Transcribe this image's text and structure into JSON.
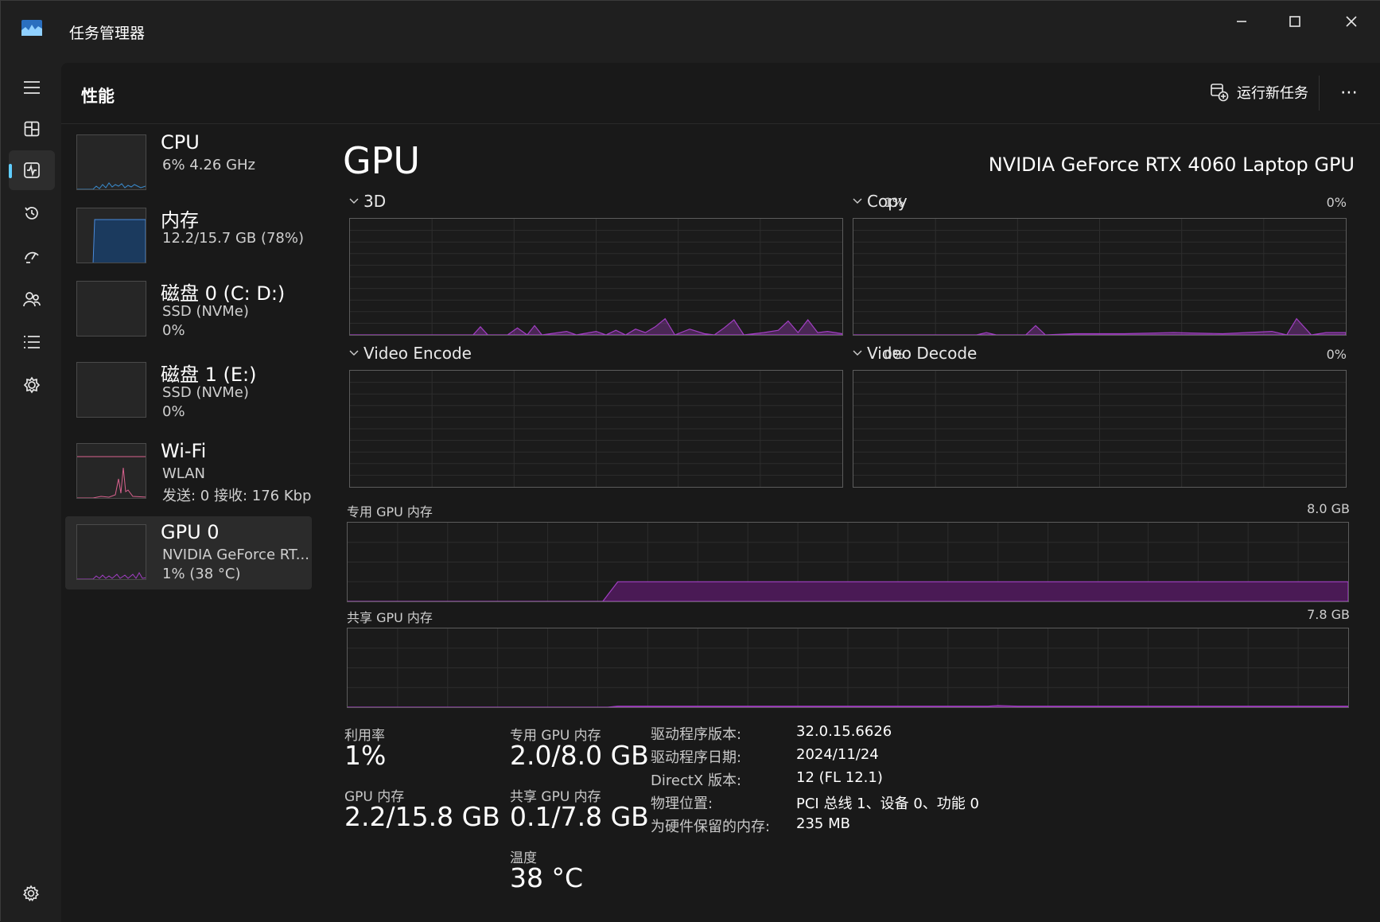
{
  "window": {
    "title": "任务管理器",
    "colors": {
      "accent": "#60cdff",
      "gpu_line": "#a23fc4",
      "gpu_fill": "#4a1a55",
      "memory_line": "#4a8ad9",
      "wifi_line": "#d9628f"
    }
  },
  "header": {
    "page_title": "性能",
    "run_task_label": "运行新任务",
    "more_label": "⋯"
  },
  "nav": {
    "items": [
      "hamburger-menu",
      "processes",
      "performance",
      "app-history",
      "startup-apps",
      "users",
      "details",
      "services"
    ],
    "active": "performance",
    "settings": "settings"
  },
  "sidebar": {
    "items": [
      {
        "name": "CPU",
        "line1": "6%  4.26 GHz",
        "line2": ""
      },
      {
        "name": "内存",
        "line1": "12.2/15.7 GB (78%)",
        "line2": ""
      },
      {
        "name": "磁盘 0 (C: D:)",
        "line1": "SSD (NVMe)",
        "line2": "0%"
      },
      {
        "name": "磁盘 1 (E:)",
        "line1": "SSD (NVMe)",
        "line2": "0%"
      },
      {
        "name": "Wi-Fi",
        "line1": "WLAN",
        "line2": "发送: 0  接收: 176 Kbps"
      },
      {
        "name": "GPU 0",
        "line1": "NVIDIA GeForce RT...",
        "line2": "1%  (38 °C)"
      }
    ],
    "selected": "GPU 0"
  },
  "gpu": {
    "title": "GPU",
    "model": "NVIDIA GeForce RTX 4060 Laptop GPU",
    "engines": [
      {
        "label": "3D",
        "pct": "1%"
      },
      {
        "label": "Copy",
        "pct": "0%"
      },
      {
        "label": "Video Encode",
        "pct": "0%"
      },
      {
        "label": "Video Decode",
        "pct": "0%"
      }
    ],
    "dedicated": {
      "label": "专用 GPU 内存",
      "max": "8.0 GB"
    },
    "shared": {
      "label": "共享 GPU 内存",
      "max": "7.8 GB"
    }
  },
  "stats": {
    "utilization_label": "利用率",
    "utilization": "1%",
    "dedicated_label": "专用 GPU 内存",
    "dedicated": "2.0/8.0 GB",
    "gpu_mem_label": "GPU 内存",
    "gpu_mem": "2.2/15.8 GB",
    "shared_label": "共享 GPU 内存",
    "shared": "0.1/7.8 GB",
    "temp_label": "温度",
    "temp": "38 °C"
  },
  "info": [
    {
      "key": "驱动程序版本:",
      "value": "32.0.15.6626"
    },
    {
      "key": "驱动程序日期:",
      "value": "2024/11/24"
    },
    {
      "key": "DirectX 版本:",
      "value": "12 (FL 12.1)"
    },
    {
      "key": "物理位置:",
      "value": "PCI 总线 1、设备 0、功能 0"
    },
    {
      "key": "为硬件保留的内存:",
      "value": "235 MB"
    }
  ],
  "chart_data": [
    {
      "type": "area",
      "name": "3D",
      "ylim": [
        0,
        100
      ],
      "values": [
        0,
        0,
        0,
        0,
        0,
        0,
        0,
        0,
        0,
        0,
        0,
        0,
        0,
        0,
        0,
        0,
        0,
        0,
        0,
        0,
        0,
        0,
        0,
        0,
        0,
        0,
        0,
        0,
        0,
        0,
        0,
        0,
        0,
        0,
        0,
        0,
        0,
        0,
        0,
        0,
        0,
        0,
        0,
        0,
        0,
        0,
        0,
        0,
        0,
        0,
        0,
        0,
        0,
        0,
        0,
        0,
        0,
        0,
        0,
        0,
        0,
        0,
        0,
        0,
        0,
        0,
        0,
        0,
        0,
        0,
        0,
        0,
        0,
        0,
        0,
        0,
        0,
        0,
        0,
        0,
        0,
        0,
        0,
        0,
        0,
        0,
        0,
        0,
        0,
        0,
        0,
        0,
        0,
        0,
        0,
        0,
        0,
        0,
        0,
        0,
        0,
        0,
        0,
        0,
        0,
        0,
        0,
        0,
        0,
        0,
        0,
        0,
        0,
        0,
        0,
        0,
        0,
        0,
        0,
        0,
        0,
        0,
        0,
        0,
        0,
        0,
        0,
        0,
        0,
        0,
        0,
        0,
        0,
        0,
        0,
        0,
        0,
        0,
        0,
        0,
        0,
        0,
        0,
        0,
        0,
        0,
        0,
        0,
        0,
        0,
        0,
        0,
        0,
        0,
        0,
        0,
        0,
        0,
        0,
        0,
        0,
        0,
        0,
        0,
        0,
        0,
        0,
        0,
        0,
        0,
        0,
        0,
        0,
        0,
        0,
        0,
        0,
        0,
        0,
        0,
        0,
        0,
        0,
        0,
        0,
        0,
        0,
        0,
        0,
        0,
        0,
        0,
        0,
        0,
        0,
        0,
        0,
        0,
        0,
        0
      ]
    },
    {
      "type": "area",
      "name": "Copy",
      "ylim": [
        0,
        100
      ]
    },
    {
      "type": "area",
      "name": "Video Encode",
      "ylim": [
        0,
        100
      ]
    },
    {
      "type": "area",
      "name": "Video Decode",
      "ylim": [
        0,
        100
      ]
    },
    {
      "type": "area",
      "name": "专用 GPU 内存",
      "ylim": [
        0,
        8.0
      ]
    },
    {
      "type": "area",
      "name": "共享 GPU 内存",
      "ylim": [
        0,
        7.8
      ]
    }
  ]
}
